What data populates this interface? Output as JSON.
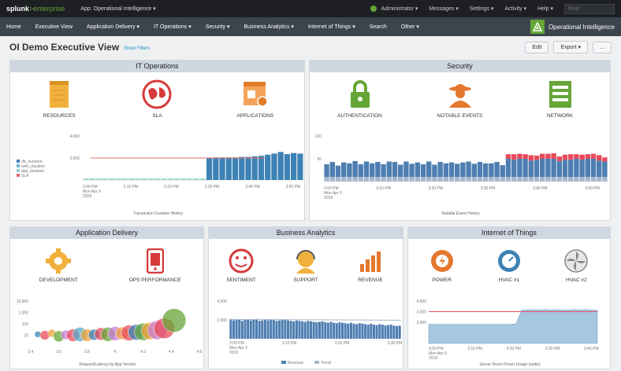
{
  "topbar": {
    "logo_main": "splunk",
    "logo_suffix": ">enterprise",
    "app_menu": "App: Operational Intelligence ▾",
    "menus": [
      "Administrator ▾",
      "Messages ▾",
      "Settings ▾",
      "Activity ▾",
      "Help ▾"
    ],
    "find_placeholder": "Find"
  },
  "navbar": {
    "items": [
      "Home",
      "Executive View",
      "Application Delivery ▾",
      "IT Operations ▾",
      "Security ▾",
      "Business Analytics ▾",
      "Internet of Things ▾",
      "Search",
      "Other ▾"
    ],
    "app_name": "Operational Intelligence"
  },
  "page": {
    "title": "OI Demo Executive View",
    "show_filters": "Show Filters",
    "edit": "Edit",
    "export": "Export ▾",
    "more": "..."
  },
  "panels": {
    "it_ops": {
      "title": "IT Operations",
      "icons": [
        {
          "label": "RESOURCES",
          "icon": "folder-icon"
        },
        {
          "label": "SLA",
          "icon": "globe-icon"
        },
        {
          "label": "APPLICATIONS",
          "icon": "application-icon"
        }
      ],
      "chart_caption": "Transaction Duration History"
    },
    "security": {
      "title": "Security",
      "icons": [
        {
          "label": "AUTHENTICATION",
          "icon": "lock-icon"
        },
        {
          "label": "NOTABLE EVENTS",
          "icon": "spy-icon"
        },
        {
          "label": "NETWORK",
          "icon": "network-icon"
        }
      ],
      "chart_caption": "Notable Event History"
    },
    "app_delivery": {
      "title": "Application Delivery",
      "icons": [
        {
          "label": "DEVELOPMENT",
          "icon": "gears-icon"
        },
        {
          "label": "OPS PERFORMANCE",
          "icon": "mobile-icon"
        }
      ],
      "chart_caption": "Request/Latency by App Version"
    },
    "business": {
      "title": "Business Analytics",
      "icons": [
        {
          "label": "SENTIMENT",
          "icon": "sentiment-icon"
        },
        {
          "label": "SUPPORT",
          "icon": "support-icon"
        },
        {
          "label": "REVENUE",
          "icon": "revenue-icon"
        }
      ],
      "chart_caption": ""
    },
    "iot": {
      "title": "Internet of Things",
      "icons": [
        {
          "label": "POWER",
          "icon": "power-icon"
        },
        {
          "label": "HVAC #1",
          "icon": "thermostat-icon"
        },
        {
          "label": "HVAC #2",
          "icon": "fan-icon"
        }
      ],
      "chart_caption": "Server Room Power Usage (watts)"
    }
  },
  "chart_data": [
    {
      "type": "bar",
      "panel": "it_ops",
      "title": "",
      "xlabel": "Transaction Duration History",
      "ylabel": "",
      "ylim": [
        0,
        4000
      ],
      "yticks": [
        2000,
        4000
      ],
      "xticks": [
        "3:00 PM\nMon Apr 9\n2018",
        "3:10 PM",
        "3:20 PM",
        "3:30 PM",
        "3:40 PM",
        "3:50 PM"
      ],
      "legend": [
        "db_duration",
        "web_duration",
        "app_duration",
        "SLA"
      ],
      "legend_position": "left",
      "colors": {
        "db_duration": "#3d82b4",
        "web_duration": "#6fb3d2",
        "app_duration": "#8dd0c6",
        "SLA": "#e36c6c"
      },
      "sla": 2000,
      "series": [
        {
          "name": "db_duration",
          "values": [
            120,
            120,
            120,
            120,
            120,
            120,
            120,
            120,
            120,
            120,
            120,
            120,
            120,
            120,
            120,
            120,
            120,
            120,
            120,
            2000,
            2050,
            2050,
            2050,
            2050,
            2100,
            2100,
            2150,
            2200,
            2300,
            2400,
            2550,
            2350,
            2450,
            2400
          ]
        }
      ],
      "grid": false
    },
    {
      "type": "bar",
      "panel": "security",
      "title": "",
      "xlabel": "Notable Event History",
      "ylabel": "",
      "ylim": [
        0,
        100
      ],
      "yticks": [
        50,
        100
      ],
      "xticks": [
        "3:00 PM\nMon Apr 9\n2018",
        "3:10 PM",
        "3:20 PM",
        "3:30 PM",
        "3:40 PM",
        "3:50 PM"
      ],
      "colors": {
        "high": "#e84b5b",
        "medium": "#4e7eb1",
        "low": "#a6b8cc"
      },
      "series": [
        {
          "name": "low",
          "values": [
            10,
            10,
            10,
            10,
            10,
            10,
            10,
            10,
            10,
            10,
            10,
            10,
            10,
            10,
            10,
            10,
            10,
            10,
            10,
            10,
            10,
            10,
            10,
            10,
            10,
            10,
            10,
            10,
            10,
            10,
            10,
            10,
            10,
            10,
            10,
            10,
            10,
            10,
            10,
            10,
            10,
            10,
            10,
            10,
            10,
            10,
            10,
            10,
            10,
            10
          ]
        },
        {
          "name": "medium",
          "values": [
            28,
            33,
            25,
            32,
            30,
            35,
            28,
            34,
            30,
            33,
            28,
            34,
            33,
            27,
            34,
            29,
            32,
            28,
            34,
            27,
            33,
            30,
            32,
            29,
            32,
            34,
            29,
            33,
            30,
            30,
            33,
            26,
            40,
            38,
            40,
            40,
            36,
            38,
            40,
            40,
            40,
            35,
            38,
            38,
            40,
            38,
            40,
            40,
            36,
            34
          ]
        },
        {
          "name": "high",
          "values": [
            0,
            0,
            0,
            0,
            0,
            0,
            0,
            0,
            0,
            0,
            0,
            0,
            0,
            0,
            0,
            0,
            0,
            0,
            0,
            0,
            0,
            0,
            0,
            0,
            0,
            0,
            0,
            0,
            0,
            0,
            0,
            0,
            10,
            12,
            11,
            10,
            12,
            9,
            11,
            11,
            12,
            10,
            11,
            12,
            10,
            11,
            10,
            11,
            12,
            9
          ]
        }
      ],
      "grid": false
    },
    {
      "type": "scatter",
      "panel": "app_delivery",
      "title": "",
      "xlabel": "Request/Latency by App Version",
      "ylabel": "",
      "ylim": [
        1,
        10000
      ],
      "yscale": "log",
      "yticks": [
        10,
        100,
        1000,
        10000
      ],
      "xlim": [
        3.4,
        4.6
      ],
      "xticks": [
        3.4,
        3.6,
        3.8,
        4.0,
        4.2,
        4.4,
        4.6
      ],
      "points": [
        {
          "x": 3.45,
          "y": 12,
          "size": 4,
          "color": "#3d82b4"
        },
        {
          "x": 3.5,
          "y": 10,
          "size": 6,
          "color": "#e84b5b"
        },
        {
          "x": 3.55,
          "y": 15,
          "size": 5,
          "color": "#f0a23b"
        },
        {
          "x": 3.6,
          "y": 8,
          "size": 7,
          "color": "#65a637"
        },
        {
          "x": 3.65,
          "y": 11,
          "size": 6,
          "color": "#c97bd6"
        },
        {
          "x": 3.7,
          "y": 10,
          "size": 8,
          "color": "#e84b5b"
        },
        {
          "x": 3.75,
          "y": 12,
          "size": 9,
          "color": "#56a8c8"
        },
        {
          "x": 3.8,
          "y": 10,
          "size": 8,
          "color": "#f0a23b"
        },
        {
          "x": 3.85,
          "y": 11,
          "size": 7,
          "color": "#3d82b4"
        },
        {
          "x": 3.9,
          "y": 13,
          "size": 8,
          "color": "#e84b5b"
        },
        {
          "x": 3.95,
          "y": 12,
          "size": 9,
          "color": "#65a637"
        },
        {
          "x": 4.0,
          "y": 14,
          "size": 9,
          "color": "#c97bd6"
        },
        {
          "x": 4.05,
          "y": 15,
          "size": 8,
          "color": "#f0a23b"
        },
        {
          "x": 4.1,
          "y": 16,
          "size": 10,
          "color": "#e84b5b"
        },
        {
          "x": 4.15,
          "y": 18,
          "size": 10,
          "color": "#3d82b4"
        },
        {
          "x": 4.2,
          "y": 20,
          "size": 11,
          "color": "#65a637"
        },
        {
          "x": 4.25,
          "y": 24,
          "size": 11,
          "color": "#f0a23b"
        },
        {
          "x": 4.3,
          "y": 28,
          "size": 12,
          "color": "#c97bd6"
        },
        {
          "x": 4.35,
          "y": 40,
          "size": 13,
          "color": "#e84b5b"
        },
        {
          "x": 4.42,
          "y": 200,
          "size": 15,
          "color": "#65a637"
        }
      ],
      "grid": false
    },
    {
      "type": "bar",
      "panel": "business",
      "title": "",
      "xlabel": "",
      "ylabel": "",
      "ylim": [
        0,
        4000
      ],
      "yticks": [
        2000,
        4000
      ],
      "xticks": [
        "3:00 PM\nMon Apr 9\n2018",
        "3:10 PM",
        "3:20 PM",
        "3:30 PM"
      ],
      "legend": [
        "Revenue",
        "Trend"
      ],
      "legend_position": "bottom",
      "colors": {
        "Revenue": "#4e7eb1",
        "Trend": "#a6b8cc"
      },
      "series": [
        {
          "name": "Revenue",
          "values": [
            2100,
            1950,
            2000,
            2050,
            1900,
            2000,
            2050,
            1950,
            2000,
            2100,
            1900,
            1950,
            2000,
            1950,
            2050,
            2000,
            1900,
            1950,
            2000,
            2050,
            1950,
            1900,
            1850,
            1950,
            1900,
            1850,
            1800,
            1900,
            1850,
            1800,
            1750,
            1800,
            1850,
            1750,
            1700,
            1800,
            1700,
            1650,
            1750,
            1700,
            1650,
            1600,
            1700,
            1600,
            1550,
            1650,
            1600,
            1550,
            1500,
            1600,
            1500,
            1450,
            1550,
            1500,
            1400,
            1450,
            1500,
            1400,
            1350,
            1400
          ]
        },
        {
          "name": "Trend",
          "values": [
            2050,
            1970
          ]
        }
      ],
      "grid": false
    },
    {
      "type": "area",
      "panel": "iot",
      "title": "",
      "xlabel": "Server Room Power Usage (watts)",
      "ylabel": "",
      "ylim": [
        0,
        4000
      ],
      "yticks": [
        2000,
        3000,
        4000
      ],
      "xticks": [
        "3:00 PM\nMon Apr 9\n2018",
        "3:10 PM",
        "3:20 PM",
        "3:30 PM",
        "3:40 PM"
      ],
      "colors": {
        "power": "#a6c7e0",
        "threshold": "#e84b5b"
      },
      "threshold": 3000,
      "series": [
        {
          "name": "power",
          "values": [
            1800,
            1800,
            1800,
            1800,
            1800,
            1800,
            1800,
            1800,
            1800,
            1800,
            1800,
            1800,
            1800,
            1800,
            1800,
            1850,
            3150,
            3150,
            3200,
            3150,
            3200,
            3150,
            3200,
            3150,
            3150,
            3200,
            3150,
            3200,
            3150,
            3150
          ]
        }
      ],
      "grid": false
    }
  ]
}
